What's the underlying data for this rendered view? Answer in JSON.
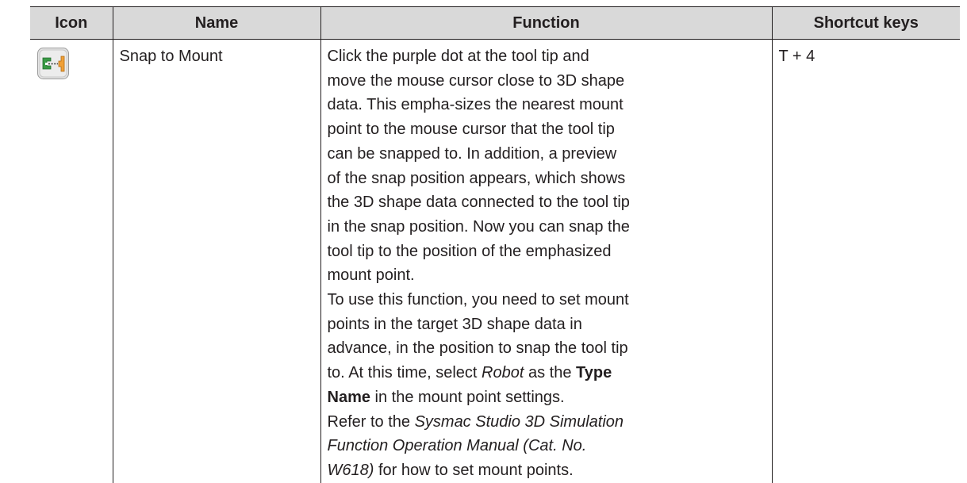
{
  "table": {
    "headers": {
      "icon": "Icon",
      "name": "Name",
      "function": "Function",
      "shortcut": "Shortcut keys"
    },
    "row": {
      "icon": "snap-to-mount-icon",
      "name": "Snap to Mount",
      "shortcut": "T + 4",
      "function": {
        "para1": "Click the purple dot at the tool tip and move the mouse cursor close to 3D shape data. This empha-sizes the nearest mount point to the mouse cursor that the tool tip can be snapped to. In addition, a preview of the snap position appears, which shows the 3D shape data connected to the tool tip in the snap position. Now you can snap the tool tip to the position of the emphasized mount point.",
        "para2_before_robot": "To use this function, you need to set mount points in the target 3D shape data in advance, in the position to snap the tool tip to. At this time, select ",
        "robot": "Robot",
        "para2_as_the": " as the ",
        "type_name": "Type Name",
        "para2_after": " in the mount point settings.",
        "para3_before": "Refer to the ",
        "manual_title": "Sysmac Studio 3D Simulation Function Operation Manual (Cat. No. W618)",
        "para3_after": " for how to set mount points."
      }
    }
  },
  "colors": {
    "header_bg": "#d9d9d9",
    "icon_green": "#3a9a46",
    "icon_orange": "#f0a038"
  }
}
